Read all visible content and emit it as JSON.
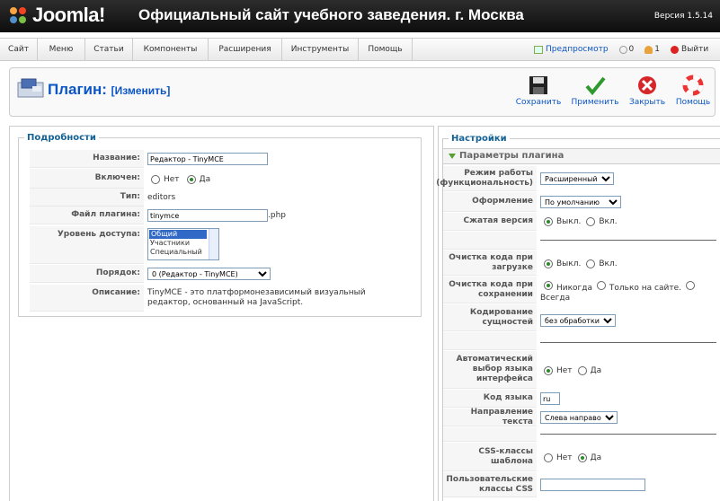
{
  "header": {
    "logo_text": "Joomla!",
    "site_title": "Официальный сайт учебного заведения. г. Москва",
    "version": "Версия 1.5.14"
  },
  "menu": {
    "items": [
      "Сайт",
      "Меню",
      "Статьи",
      "Компоненты",
      "Расширения",
      "Инструменты",
      "Помощь"
    ],
    "preview": "Предпросмотр",
    "messages_count": "0",
    "users_count": "1",
    "logout": "Выйти"
  },
  "toolbar": {
    "title": "Плагин:",
    "subtitle": "[Изменить]",
    "save": "Сохранить",
    "apply": "Применить",
    "close": "Закрыть",
    "help": "Помощь"
  },
  "details": {
    "legend": "Подробности",
    "name_label": "Название:",
    "name_value": "Редактор - TinyMCE",
    "enabled_label": "Включен:",
    "no": "Нет",
    "yes": "Да",
    "type_label": "Тип:",
    "type_value": "editors",
    "file_label": "Файл плагина:",
    "file_value": "tinymce",
    "file_ext": ".php",
    "access_label": "Уровень доступа:",
    "access_options": [
      "Общий",
      "Участники",
      "Специальный"
    ],
    "order_label": "Порядок:",
    "order_value": "0 (Редактор - TinyMCE)",
    "desc_label": "Описание:",
    "desc_value": "TinyMCE - это платформонезависимый визуальный редактор, основанный на JavaScript."
  },
  "settings": {
    "legend": "Настройки",
    "panel_title": "Параметры плагина",
    "mode_label": "Режим работы (функциональность)",
    "mode_value": "Расширенный",
    "skin_label": "Оформление",
    "skin_value": "По умолчанию",
    "compressed_label": "Сжатая версия",
    "off": "Выкл.",
    "on": "Вкл.",
    "cleanup_load_label": "Очистка кода при загрузке",
    "cleanup_save_label": "Очистка кода при сохранении",
    "never": "Никогда",
    "front_only": "Только на сайте.",
    "always": "Всегда",
    "entity_label": "Кодирование сущностей",
    "entity_value": "без обработки",
    "autolang_label": "Автоматический выбор языка интерфейса",
    "no": "Нет",
    "yes": "Да",
    "langcode_label": "Код языка",
    "langcode_value": "ru",
    "dir_label": "Направление текста",
    "dir_value": "Слева направо",
    "css_label": "CSS-классы шаблона",
    "custom_css_label": "Пользовательские классы CSS"
  }
}
